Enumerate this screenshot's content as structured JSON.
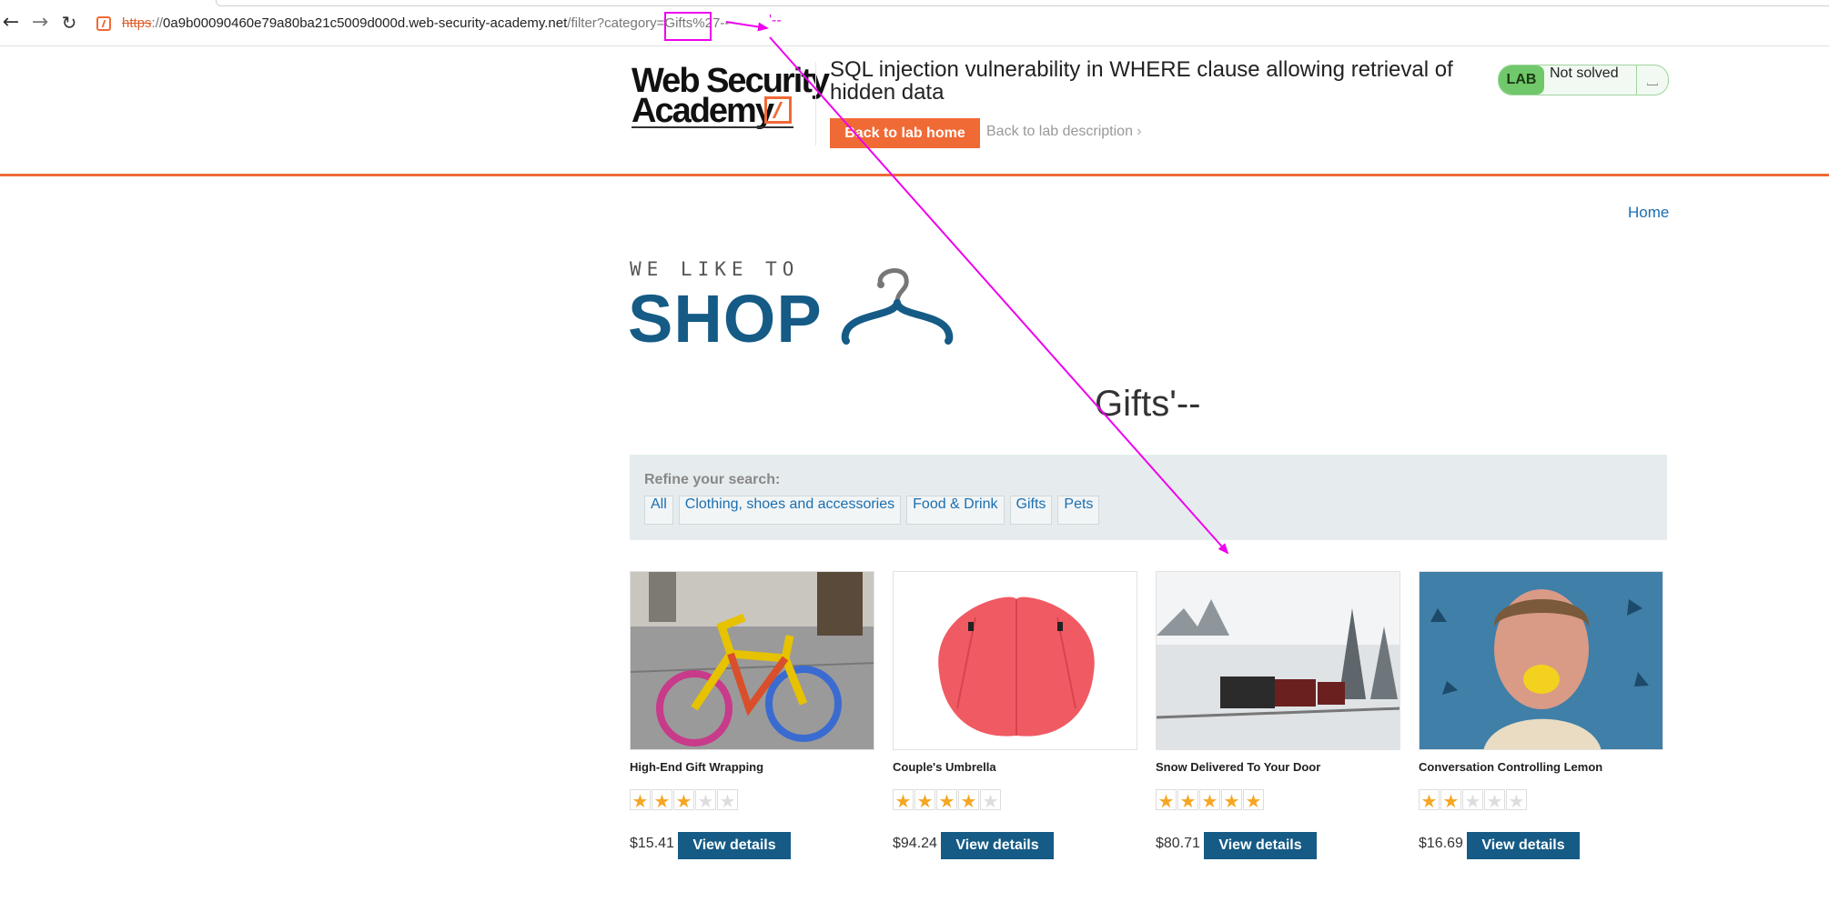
{
  "browser": {
    "url_scheme": "https",
    "url_sep": "://",
    "url_host": "0a9b00090460e79a80ba21c5009d000d.web-security-academy.net",
    "url_path": "/filter?category=Gifts%27--",
    "back_icon": "arrow-left-icon",
    "forward_icon": "arrow-right-icon",
    "reload_icon": "reload-icon"
  },
  "lab_header": {
    "logo_line1": "Web Security",
    "logo_line2": "Academy",
    "title": "SQL injection vulnerability in WHERE clause allowing retrieval of hidden data",
    "back_home": "Back to lab home",
    "back_description": "Back to lab description",
    "badge": "LAB",
    "status": "Not solved",
    "accent_color": "#f06a36"
  },
  "nav": {
    "home": "Home"
  },
  "shop_logo": {
    "top": "WE LIKE TO",
    "main": "SHOP"
  },
  "category_title": "Gifts'--",
  "filters": {
    "label": "Refine your search:",
    "links": [
      "All",
      "Clothing, shoes and accessories",
      "Food & Drink",
      "Gifts",
      "Pets"
    ]
  },
  "products": [
    {
      "name": "High-End Gift Wrapping",
      "rating": 3,
      "price": "$15.41",
      "button": "View details"
    },
    {
      "name": "Couple's Umbrella",
      "rating": 4,
      "price": "$94.24",
      "button": "View details"
    },
    {
      "name": "Snow Delivered To Your Door",
      "rating": 5,
      "price": "$80.71",
      "button": "View details"
    },
    {
      "name": "Conversation Controlling Lemon",
      "rating": 2,
      "price": "$16.69",
      "button": "View details"
    }
  ],
  "annotation": {
    "text": "'--",
    "color": "#ee00ee"
  }
}
